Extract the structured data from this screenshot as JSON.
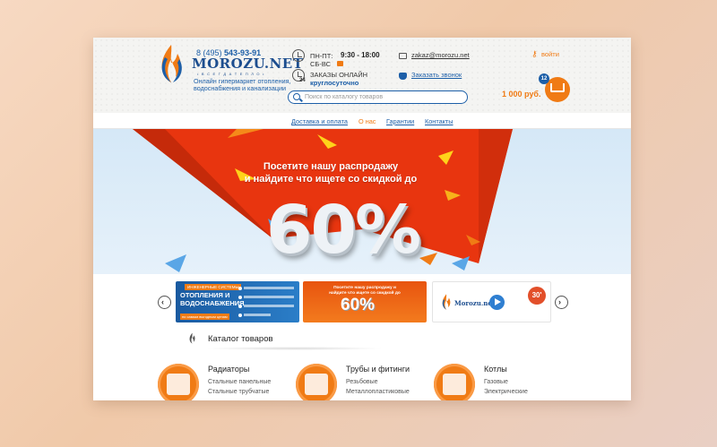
{
  "header": {
    "phone_prefix": "8 (495)",
    "phone_number": "543-93-91",
    "brand": "MOROZU.NET",
    "brand_tagline": "• В С Е Г Д А  Т Е П Л О •",
    "tagline": "Онлайн гипермаркет отопления, водоснабжения и канализации",
    "hours_label": "ПН-ПТ:\nСБ-ВС",
    "hours_value": "9:30 - 18:00",
    "orders_label": "ЗАКАЗЫ ОНЛАЙН",
    "orders_value": "круглосуточно",
    "orders_badge": "24",
    "email": "zakaz@morozu.net",
    "callback": "Заказать звонок",
    "login": "войти",
    "search_placeholder": "Поиск по каталогу товаров",
    "cart_total": "1 000 руб.",
    "cart_count": "12"
  },
  "nav": {
    "items": [
      {
        "label": "Доставка и оплата"
      },
      {
        "label": "О нас"
      },
      {
        "label": "Гарантии"
      },
      {
        "label": "Контакты"
      }
    ]
  },
  "hero": {
    "line1": "Посетите нашу распродажу",
    "line2": "и найдите что ищете со скидкой до",
    "percent": "60%"
  },
  "slider": {
    "slide1_tag": "ИНЖЕНЕРНЫЕ СИСТЕМЫ",
    "slide1_title": "ОТОПЛЕНИЯ И ВОДОСНАБЖЕНИЯ",
    "slide1_sub": "по самым выгодным ценам",
    "slide2_text": "Посетите нашу распродажу и найдите что ищете со скидкой до",
    "slide2_percent": "60%",
    "slide3_brand": "Morozu.net",
    "slide3_badge": "30'"
  },
  "catalog": {
    "title": "Каталог товаров",
    "categories": [
      {
        "name": "Радиаторы",
        "links": [
          "Стальные панельные",
          "Стальные трубчатые"
        ]
      },
      {
        "name": "Трубы и фитинги",
        "links": [
          "Резьбовые",
          "Металлопластиковые"
        ]
      },
      {
        "name": "Котлы",
        "links": [
          "Газовые",
          "Электрические"
        ]
      }
    ]
  },
  "colors": {
    "accent": "#f07b15",
    "brand_blue": "#1d5fa8",
    "hero_red": "#e8350f"
  }
}
